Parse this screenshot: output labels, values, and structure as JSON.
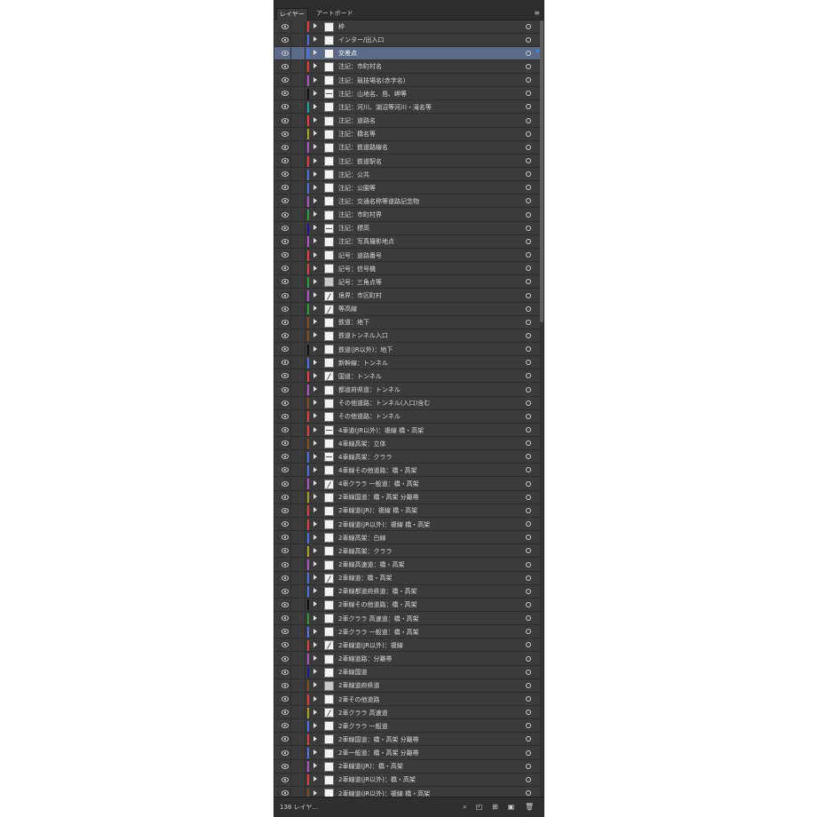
{
  "panel": {
    "tabs": [
      "レイヤー",
      "アートボード"
    ],
    "menu_icon": "panel-menu-icon"
  },
  "footer": {
    "count_label": "138 レイヤ...",
    "icons": [
      "locate-object-icon",
      "make-clipping-mask-icon",
      "new-sublayer-icon",
      "new-layer-icon",
      "delete-layer-icon"
    ]
  },
  "layers": [
    {
      "name": "枠",
      "color": "#e03c3c",
      "thumb": "plain"
    },
    {
      "name": "インター/出入口",
      "color": "#4f6fe6",
      "thumb": "plain"
    },
    {
      "name": "交差点",
      "color": "#4f6fe6",
      "thumb": "plain",
      "selected": true
    },
    {
      "name": "注記：市町村名",
      "color": "#e03c3c",
      "thumb": "plain"
    },
    {
      "name": "注記：競技場名(赤字名)",
      "color": "#b050d0",
      "thumb": "plain"
    },
    {
      "name": "注記：山地名、島、岬等",
      "color": "#111111",
      "thumb": "line"
    },
    {
      "name": "注記：河川、湖沼等河川・滝名等",
      "color": "#1aa0a0",
      "thumb": "plain"
    },
    {
      "name": "注記：道路名",
      "color": "#e03c3c",
      "thumb": "plain"
    },
    {
      "name": "注記：橋名等",
      "color": "#b0a020",
      "thumb": "plain"
    },
    {
      "name": "注記：鉄道路線名",
      "color": "#b050d0",
      "thumb": "plain"
    },
    {
      "name": "注記：鉄道駅名",
      "color": "#e03c3c",
      "thumb": "plain"
    },
    {
      "name": "注記：公共",
      "color": "#4f6fe6",
      "thumb": "plain"
    },
    {
      "name": "注記：公園等",
      "color": "#4f6fe6",
      "thumb": "plain"
    },
    {
      "name": "注記：交通名称等道路記念物",
      "color": "#b050d0",
      "thumb": "plain"
    },
    {
      "name": "注記：市町村界",
      "color": "#2d9a3a",
      "thumb": "plain"
    },
    {
      "name": "注記：標高",
      "color": "#1a1aa0",
      "thumb": "line"
    },
    {
      "name": "注記：写真撮影地点",
      "color": "#b050d0",
      "thumb": "plain"
    },
    {
      "name": "記号：道路番号",
      "color": "#e03c3c",
      "thumb": "plain"
    },
    {
      "name": "記号：信号機",
      "color": "#e03c3c",
      "thumb": "plain"
    },
    {
      "name": "記号：三角点等",
      "color": "#2d9a3a",
      "thumb": "grey"
    },
    {
      "name": "境界：市区町村",
      "color": "#b050d0",
      "thumb": "diag"
    },
    {
      "name": "等高線",
      "color": "#2d9a3a",
      "thumb": "diag"
    },
    {
      "name": "鉄道：地下",
      "color": "#8a4a20",
      "thumb": "plain"
    },
    {
      "name": "鉄道トンネル入口",
      "color": "#8a4a20",
      "thumb": "plain"
    },
    {
      "name": "鉄道(JR以外)：地下",
      "color": "#111111",
      "thumb": "plain"
    },
    {
      "name": "新幹線：トンネル",
      "color": "#4f6fe6",
      "thumb": "plain"
    },
    {
      "name": "国道：トンネル",
      "color": "#e03c3c",
      "thumb": "diag"
    },
    {
      "name": "都道府県道：トンネル",
      "color": "#b050d0",
      "thumb": "plain"
    },
    {
      "name": "その他道路：トンネル(入口)含む",
      "color": "#8a4a20",
      "thumb": "plain"
    },
    {
      "name": "その他道路：トンネル",
      "color": "#e03c3c",
      "thumb": "plain"
    },
    {
      "name": "4車道(JR以外)：複線 橋・高架",
      "color": "#e03c3c",
      "thumb": "line"
    },
    {
      "name": "4車線高架：立体",
      "color": "#8a4a20",
      "thumb": "plain"
    },
    {
      "name": "4車線高架：クララ",
      "color": "#4f6fe6",
      "thumb": "line"
    },
    {
      "name": "4車線その他道路：橋・高架",
      "color": "#4f6fe6",
      "thumb": "plain"
    },
    {
      "name": "4車クララ 一般道：橋・高架",
      "color": "#b050d0",
      "thumb": "diag"
    },
    {
      "name": "2車線国道：橋・高架 分離帯",
      "color": "#b0a020",
      "thumb": "plain"
    },
    {
      "name": "2車線道(JR)：複線 橋・高架",
      "color": "#e03c3c",
      "thumb": "plain"
    },
    {
      "name": "2車線道(JR以外)：複線 橋・高架",
      "color": "#e03c3c",
      "thumb": "plain"
    },
    {
      "name": "2車線高架：白線",
      "color": "#4f6fe6",
      "thumb": "plain"
    },
    {
      "name": "2車線高架：クララ",
      "color": "#b0a020",
      "thumb": "plain"
    },
    {
      "name": "2車線高速道：橋・高架",
      "color": "#b050d0",
      "thumb": "plain"
    },
    {
      "name": "2車線道：橋・高架",
      "color": "#4f6fe6",
      "thumb": "diag"
    },
    {
      "name": "2車線都道府県道：橋・高架",
      "color": "#4f6fe6",
      "thumb": "plain"
    },
    {
      "name": "2車線その他道路：橋・高架",
      "color": "#111111",
      "thumb": "plain"
    },
    {
      "name": "2車クララ 高速道：橋・高架",
      "color": "#2d9a3a",
      "thumb": "plain"
    },
    {
      "name": "2車クララ 一般道：橋・高架",
      "color": "#4f6fe6",
      "thumb": "plain"
    },
    {
      "name": "2車線道(JR以外)：複線",
      "color": "#e03c3c",
      "thumb": "diag"
    },
    {
      "name": "2車線道路：分離帯",
      "color": "#b050d0",
      "thumb": "plain"
    },
    {
      "name": "2車線国道",
      "color": "#1a1aa0",
      "thumb": "plain"
    },
    {
      "name": "2車線道府県道",
      "color": "#8a4a20",
      "thumb": "grey"
    },
    {
      "name": "2車その他道路",
      "color": "#e03c3c",
      "thumb": "plain"
    },
    {
      "name": "2車クララ 高速道",
      "color": "#b0a020",
      "thumb": "diag"
    },
    {
      "name": "2車クララ 一般道",
      "color": "#4f6fe6",
      "thumb": "plain"
    },
    {
      "name": "2車線国道：橋・高架 分離帯",
      "color": "#e03c3c",
      "thumb": "plain"
    },
    {
      "name": "2車一般道：橋・高架 分離帯",
      "color": "#4f6fe6",
      "thumb": "plain"
    },
    {
      "name": "2車線道(JR)：橋・高架",
      "color": "#b050d0",
      "thumb": "plain"
    },
    {
      "name": "2車線道(JR以外)：橋・高架",
      "color": "#e03c3c",
      "thumb": "plain"
    },
    {
      "name": "2車線道(JR以外)：複線 橋・高架",
      "color": "#8a4a20",
      "thumb": "plain"
    }
  ]
}
